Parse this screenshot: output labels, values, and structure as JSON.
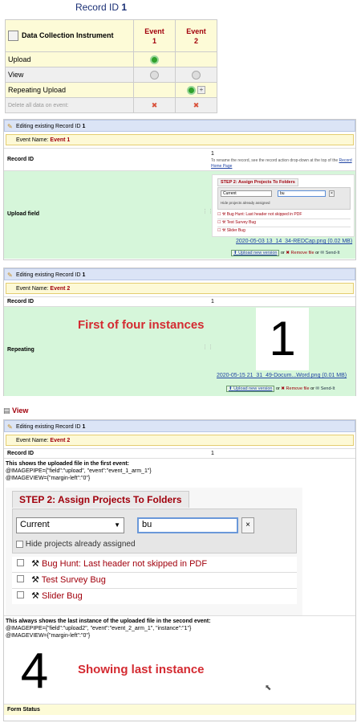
{
  "record_title": {
    "prefix": "Record ID",
    "id": "1"
  },
  "grid": {
    "instrument_header": "Data Collection Instrument",
    "events": [
      {
        "line1": "Event",
        "line2": "1"
      },
      {
        "line1": "Event",
        "line2": "2"
      }
    ],
    "rows": [
      "Upload",
      "View",
      "Repeating Upload"
    ],
    "delete_label": "Delete all data on event:"
  },
  "form1": {
    "editing": "Editing existing Record ID",
    "record_id": "1",
    "event_label": "Event Name:",
    "event_name": "Event 1",
    "record_id_label": "Record ID",
    "record_value": "1",
    "rename_note_1": "To rename the record, see the record action drop-down at the top of the",
    "rename_note_link": "Record Home Page",
    "upload_label": "Upload field",
    "thumb": {
      "step": "STEP 2: Assign Projects To Folders",
      "select": "Current",
      "search": "bu",
      "hide": "Hide projects already assigned",
      "items": [
        "Bug Hunt: Last header not skipped in PDF",
        "Test Survey Bug",
        "Slider Bug"
      ]
    },
    "file_link": "2020-05-03 13_14_34-REDCap.png (0.02 MB)",
    "upload_new": "Upload new version",
    "or1": "or",
    "remove": "Remove file",
    "or2": "or",
    "send": "Send-It"
  },
  "form2": {
    "editing": "Editing existing Record ID",
    "record_id": "1",
    "event_label": "Event Name:",
    "event_name": "Event 2",
    "record_id_label": "Record ID",
    "record_value": "1",
    "repeating_label": "Repeating",
    "banner": "First of four instances",
    "big_number": "1",
    "file_link": "2020-05-15 21_31_49-Docum...Word.png (0.01 MB)",
    "upload_new": "Upload new version",
    "or1": "or",
    "remove": "Remove file",
    "or2": "or",
    "send": "Send-It"
  },
  "view_heading": "View",
  "form3": {
    "editing": "Editing existing Record ID",
    "record_id": "1",
    "event_label": "Event Name:",
    "event_name": "Event 2",
    "record_id_label": "Record ID",
    "record_value": "1",
    "desc1": "This shows the uploaded file in the first event:",
    "code1a": "@IMAGEPIPE={\"field\":\"upload\", \"event\":\"event_1_arm_1\"}",
    "code1b": "@IMAGEVIEW={\"margin-left\":\"0\"}",
    "big": {
      "step": "STEP 2: Assign Projects To Folders",
      "select": "Current",
      "search": "bu",
      "hide": "Hide projects already assigned",
      "items": [
        "Bug Hunt: Last header not skipped in PDF",
        "Test Survey Bug",
        "Slider Bug"
      ]
    },
    "desc2": "This always shows the last instance of the uploaded file in the second event:",
    "code2a": "@IMAGEPIPE={\"field\":\"upload2\", \"event\":\"event_2_arm_1\", \"instance\":\"1\"}",
    "code2b": "@IMAGEVIEW={\"margin-left\":\"0\"}",
    "big_number": "4",
    "banner": "Showing last instance",
    "form_status": "Form Status"
  }
}
